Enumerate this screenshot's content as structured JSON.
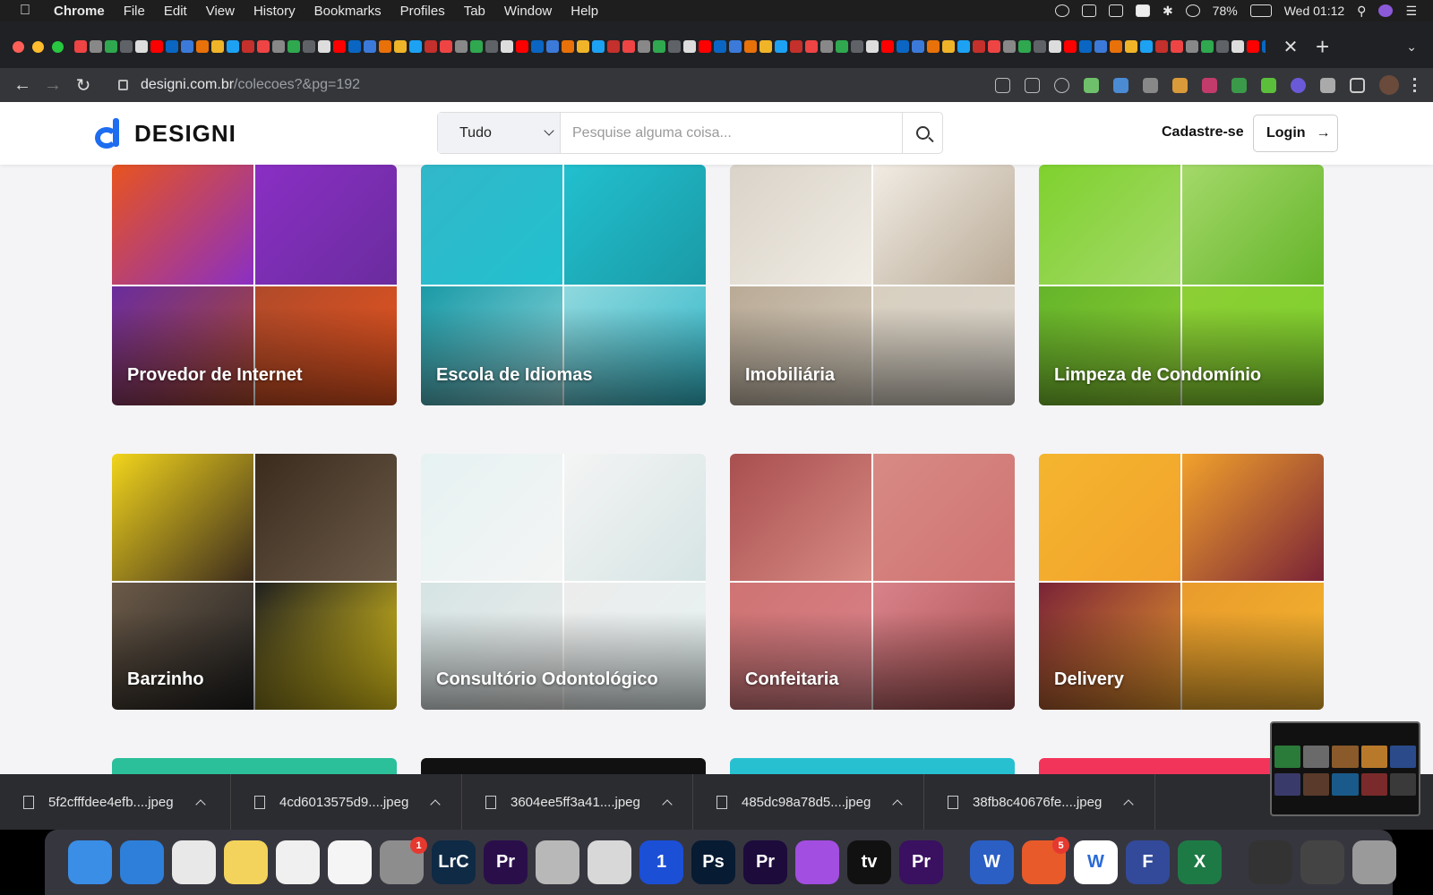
{
  "menubar": {
    "app_name": "Chrome",
    "menus": [
      "File",
      "Edit",
      "View",
      "History",
      "Bookmarks",
      "Profiles",
      "Tab",
      "Window",
      "Help"
    ],
    "battery": "78%",
    "clock": "Wed 01:12"
  },
  "browser": {
    "url_host": "designi.com.br",
    "url_path": "/colecoes?&pg=192"
  },
  "site": {
    "logo_text": "DESIGNI",
    "search": {
      "category": "Tudo",
      "placeholder": "Pesquise alguma coisa..."
    },
    "signup_label": "Cadastre-se",
    "login_label": "Login"
  },
  "collections": [
    {
      "title": "Provedor de Internet",
      "colors": [
        "#e8541e",
        "#8a2fc4",
        "#6a2c9e",
        "#b04a2a"
      ]
    },
    {
      "title": "Escola de Idiomas",
      "colors": [
        "#31b8c9",
        "#22c0cf",
        "#1a9aa6",
        "#8fd8de"
      ]
    },
    {
      "title": "Imobiliária",
      "colors": [
        "#d9d3c9",
        "#f1ece4",
        "#b9aa96",
        "#d8cfc0"
      ]
    },
    {
      "title": "Limpeza de Condomínio",
      "colors": [
        "#7fd12e",
        "#a4d96a",
        "#65b42a",
        "#8ccf34"
      ]
    },
    {
      "title": "Barzinho",
      "colors": [
        "#f2d51c",
        "#3b2b1d",
        "#6b5a48",
        "#1f1f1f"
      ]
    },
    {
      "title": "Consultório Odontológico",
      "colors": [
        "#e6f2f2",
        "#f4f4f4",
        "#d6e4e4",
        "#ececec"
      ]
    },
    {
      "title": "Confeitaria",
      "colors": [
        "#a84f4f",
        "#d88a84",
        "#cf7373",
        "#d9828a"
      ]
    },
    {
      "title": "Delivery",
      "colors": [
        "#f4b52e",
        "#f2a22c",
        "#7a2337",
        "#e99b2c"
      ]
    }
  ],
  "downloads": [
    {
      "name": "5f2cfffdee4efb....jpeg"
    },
    {
      "name": "4cd6013575d9....jpeg"
    },
    {
      "name": "3604ee5ff3a41....jpeg"
    },
    {
      "name": "485dc98a78d5....jpeg"
    },
    {
      "name": "38fb8c40676fe....jpeg"
    }
  ],
  "dock": [
    {
      "name": "finder-icon",
      "label": "",
      "color": "#3a8ee6"
    },
    {
      "name": "safari-icon",
      "label": "",
      "color": "#2d7fd9"
    },
    {
      "name": "chrome-icon",
      "label": "",
      "color": "#e8e8e8"
    },
    {
      "name": "notes-icon",
      "label": "",
      "color": "#f3d35b"
    },
    {
      "name": "textedit-icon",
      "label": "",
      "color": "#f0f0f0"
    },
    {
      "name": "photos-icon",
      "label": "",
      "color": "#f5f5f5"
    },
    {
      "name": "system-preferences-icon",
      "label": "",
      "color": "#8d8d8d",
      "badge": "1"
    },
    {
      "name": "lightroom-classic-icon",
      "label": "LrC",
      "color": "#0e2a45"
    },
    {
      "name": "premiere-pro-icon",
      "label": "Pr",
      "color": "#2a0e4a"
    },
    {
      "name": "no-entry-app-icon",
      "label": "",
      "color": "#b8b8b8"
    },
    {
      "name": "preview-icon",
      "label": "",
      "color": "#d8d8d8"
    },
    {
      "name": "1password-icon",
      "label": "1",
      "color": "#1b4fd6"
    },
    {
      "name": "photoshop-icon",
      "label": "Ps",
      "color": "#071b33"
    },
    {
      "name": "premiere-pro-2-icon",
      "label": "Pr",
      "color": "#1c0b3b"
    },
    {
      "name": "podcasts-icon",
      "label": "",
      "color": "#a24ee0"
    },
    {
      "name": "apple-tv-icon",
      "label": "tv",
      "color": "#111111"
    },
    {
      "name": "premiere-pro-3-icon",
      "label": "Pr",
      "color": "#3a1060"
    },
    {
      "name": "word-icon",
      "label": "W",
      "color": "#2b5fc4"
    },
    {
      "name": "office-icon",
      "label": "",
      "color": "#e85a2a",
      "badge": "5"
    },
    {
      "name": "w-app-icon",
      "label": "W",
      "color": "#ffffff"
    },
    {
      "name": "f-app-icon",
      "label": "F",
      "color": "#334a9a"
    },
    {
      "name": "excel-icon",
      "label": "X",
      "color": "#1d7a45"
    },
    {
      "name": "screenshot-thumb-icon",
      "label": "",
      "color": "#333333"
    },
    {
      "name": "screenshot-thumb-2-icon",
      "label": "",
      "color": "#444444"
    },
    {
      "name": "trash-icon",
      "label": "",
      "color": "#9a9a9a"
    }
  ]
}
